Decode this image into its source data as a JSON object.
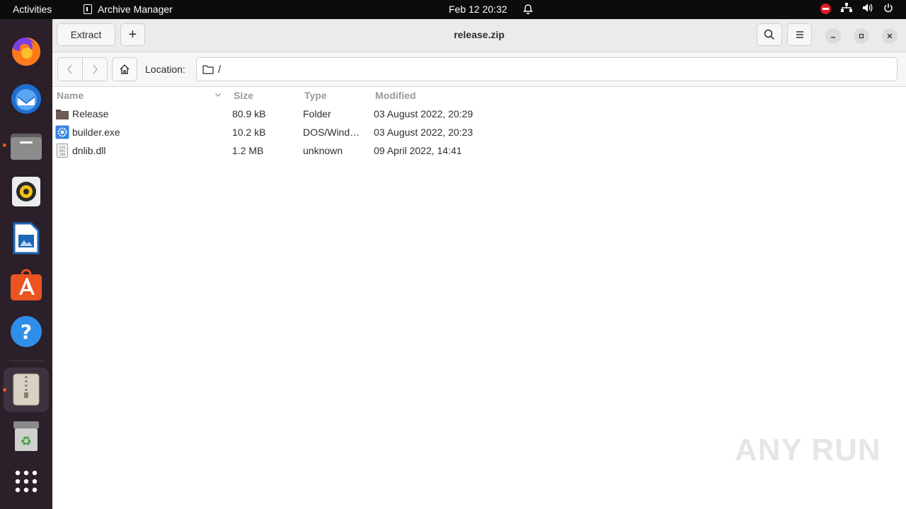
{
  "topbar": {
    "activities": "Activities",
    "app_name": "Archive Manager",
    "clock": "Feb 12  20:32"
  },
  "dock": {
    "apps": [
      "firefox",
      "thunderbird",
      "files",
      "rhythmbox",
      "libreoffice-writer",
      "ubuntu-software",
      "help",
      "archive-manager",
      "trash",
      "show-apps"
    ]
  },
  "headerbar": {
    "extract_label": "Extract",
    "add_label": "+",
    "title": "release.zip"
  },
  "location": {
    "label": "Location:",
    "path": "/"
  },
  "columns": {
    "name": "Name",
    "size": "Size",
    "type": "Type",
    "modified": "Modified"
  },
  "files": [
    {
      "name": "Release",
      "size": "80.9 kB",
      "type": "Folder",
      "modified": "03 August 2022, 20:29",
      "icon": "folder-icon"
    },
    {
      "name": "builder.exe",
      "size": "10.2 kB",
      "type": "DOS/Wind…",
      "modified": "03 August 2022, 20:23",
      "icon": "executable-icon"
    },
    {
      "name": "dnlib.dll",
      "size": "1.2 MB",
      "type": "unknown",
      "modified": "09 April 2022, 14:41",
      "icon": "binary-file-icon"
    }
  ],
  "watermark": "ANY RUN"
}
